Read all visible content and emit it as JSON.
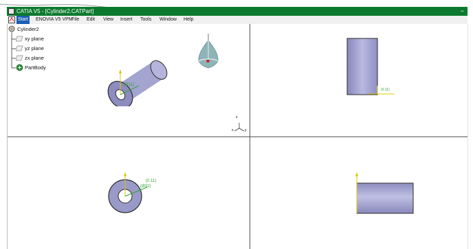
{
  "window": {
    "title": "CATIA V5 - [Cylinder2.CATPart]",
    "min_glyph": "−"
  },
  "menu": [
    "Start",
    "ENOVIA V5 VPM",
    "File",
    "Edit",
    "View",
    "Insert",
    "Tools",
    "Window",
    "Help"
  ],
  "tree": {
    "root": "Cylinder2",
    "items": [
      "xy plane",
      "yz plane",
      "zx plane",
      "PartBody"
    ]
  },
  "annotations": {
    "dim_iso": "(Ø11)",
    "dim_front": "(0.11)",
    "dim_top_1": "(0.11)",
    "dim_top_2": "(Ø32)",
    "axis_x": "x",
    "axis_y": "y",
    "axis_z": "z"
  },
  "colors": {
    "titlebar": "#0c7a2e",
    "cylinder_body": "#9a9ac8",
    "cylinder_edge": "#2a2a2a",
    "axis_yellow": "#d8c800",
    "dim_green": "#2ea52e",
    "compass": "#8fb4b8"
  }
}
